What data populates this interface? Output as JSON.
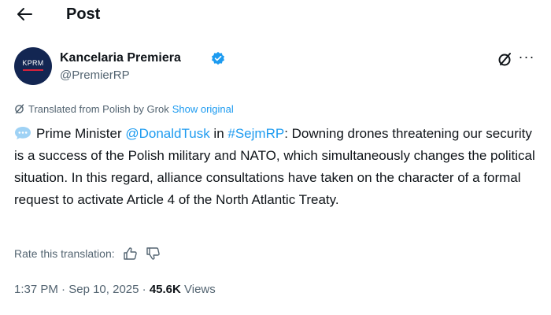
{
  "header": {
    "title": "Post",
    "back_icon": "arrow-left-icon"
  },
  "author": {
    "name": "Kancelaria Premiera",
    "handle": "@PremierRP",
    "avatar_text": "KPRM",
    "verified_icon": "verified-badge-icon",
    "verified_color": "#1d9bf0",
    "avatar_color": "#132652",
    "avatar_stripe_color": "#d6223b"
  },
  "actions": {
    "grok_icon": "grok-icon",
    "more_label": "···"
  },
  "translation": {
    "note": "Translated from Polish by Grok",
    "show_original": "Show original",
    "icon": "translate-icon"
  },
  "tweet": {
    "emoji": "speech-bubble-icon",
    "text_part1": "Prime Minister ",
    "mention": "@DonaldTusk",
    "text_part2": " in ",
    "hashtag": "#SejmRP",
    "text_part3": ": Downing drones threatening our security is a success of the Polish military and NATO, which simultaneously changes the political situation. In this regard, alliance consultations have taken on the character of a formal request to activate Article 4 of the North Atlantic Treaty."
  },
  "rating": {
    "label": "Rate this translation:",
    "thumbs_up_icon": "thumbs-up-icon",
    "thumbs_down_icon": "thumbs-down-icon"
  },
  "meta": {
    "time": "1:37 PM",
    "separator1": " · ",
    "date": "Sep 10, 2025",
    "separator2": " · ",
    "views_count": "45.6K",
    "views_label": " Views"
  },
  "colors": {
    "link": "#1d9bf0",
    "text": "#0f1419",
    "secondary": "#536471"
  }
}
